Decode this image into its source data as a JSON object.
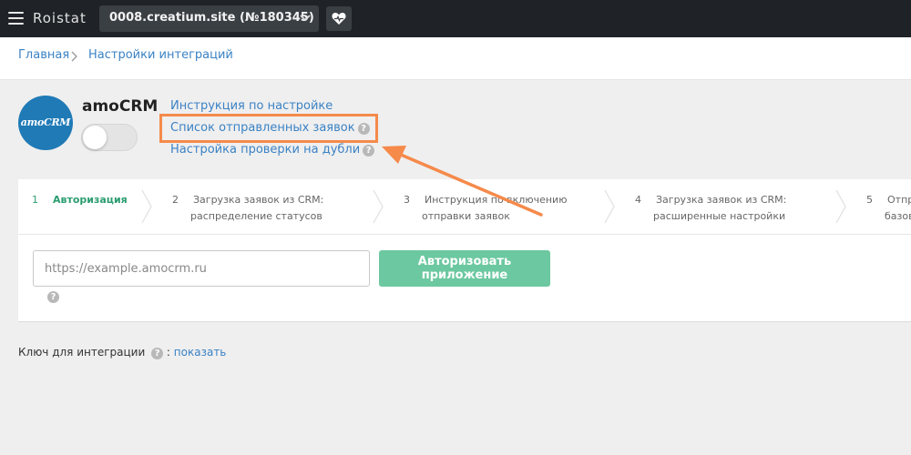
{
  "topbar": {
    "brand": "Roistat",
    "project": "0008.creatium.site (№180345)"
  },
  "breadcrumb": {
    "home": "Главная",
    "current": "Настройки интеграций"
  },
  "integration": {
    "logo_text": "amoCRM",
    "name": "amoCRM",
    "enabled": false,
    "links": {
      "instructions": "Инструкция по настройке",
      "sent_list": "Список отправленных заявок",
      "duplicates": "Настройка проверки на дубли"
    }
  },
  "steps": [
    {
      "num": "1",
      "line1": "Авторизация",
      "line2": "",
      "active": true
    },
    {
      "num": "2",
      "line1": "Загрузка заявок из CRM:",
      "line2": "распределение статусов",
      "active": false
    },
    {
      "num": "3",
      "line1": "Инструкция по включению",
      "line2": "отправки заявок",
      "active": false
    },
    {
      "num": "4",
      "line1": "Загрузка заявок из CRM:",
      "line2": "расширенные настройки",
      "active": false
    },
    {
      "num": "5",
      "line1": "Отпр",
      "line2": "базов",
      "active": false
    }
  ],
  "auth": {
    "url_value": "",
    "url_placeholder": "https://example.amocrm.ru",
    "button_label": "Авторизовать приложение"
  },
  "key": {
    "label": "Ключ для интеграции",
    "colon": ":",
    "show_label": "показать"
  },
  "colors": {
    "topbar_bg": "#1f2327",
    "link": "#3b82c4",
    "active_step": "#2a9d6f",
    "button": "#6cc8a0",
    "highlight": "#f58a4b",
    "logo_bg": "#1f7ab6"
  },
  "icons": [
    "menu-icon",
    "chevron-down-icon",
    "heart-pulse-icon",
    "chevron-right-icon",
    "help-icon"
  ]
}
